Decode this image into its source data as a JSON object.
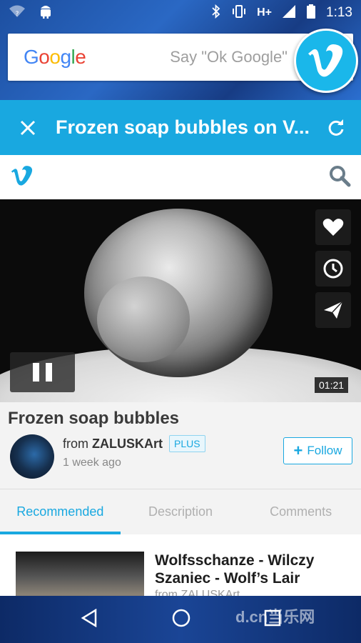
{
  "statusbar": {
    "network": "H+",
    "time": "1:13"
  },
  "google": {
    "logo": "Google",
    "hint": "Say \"Ok Google\""
  },
  "appbar": {
    "title": "Frozen soap bubbles on V..."
  },
  "video": {
    "duration": "01:21"
  },
  "info": {
    "title": "Frozen soap bubbles",
    "from_prefix": "from",
    "author": "ZALUSKArt",
    "badge": "PLUS",
    "posted": "1 week ago",
    "follow_label": "Follow"
  },
  "tabs": [
    {
      "label": "Recommended",
      "active": true
    },
    {
      "label": "Description",
      "active": false
    },
    {
      "label": "Comments",
      "active": false
    }
  ],
  "recommended": [
    {
      "title": "Wolfsschanze - Wilczy Szaniec - Wolf’s Lair",
      "from": "from ZALUSKArt"
    }
  ],
  "watermark": "d.cn当乐网",
  "colors": {
    "accent": "#19a8e0",
    "vimeo_blue": "#1ab7ea"
  }
}
